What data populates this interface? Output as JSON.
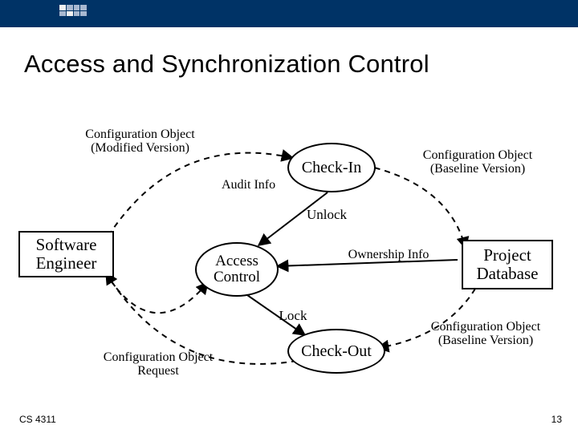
{
  "title": "Access and Synchronization Control",
  "nodes": {
    "software_engineer": "Software\nEngineer",
    "project_database": "Project\nDatabase",
    "check_in": "Check-In",
    "access_control": "Access\nControl",
    "check_out": "Check-Out"
  },
  "labels": {
    "conf_obj_modified": "Configuration Object\n(Modified Version)",
    "conf_obj_baseline_top": "Configuration Object\n(Baseline Version)",
    "conf_obj_baseline_bottom": "Configuration Object\n(Baseline Version)",
    "conf_obj_request": "Configuration Object\nRequest",
    "audit_info": "Audit Info",
    "unlock": "Unlock",
    "ownership_info": "Ownership Info",
    "lock": "Lock"
  },
  "footer": {
    "course": "CS 4311",
    "slide": "13"
  }
}
